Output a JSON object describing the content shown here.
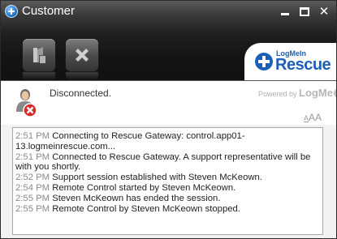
{
  "window": {
    "title": "Customer",
    "controls": {
      "minimize_icon": "minimize-icon",
      "maximize_icon": "maximize-icon",
      "close_symbol": "✕"
    }
  },
  "toolbar": {
    "buttons": [
      {
        "name": "reconnect",
        "icon": "connect-icon"
      },
      {
        "name": "end-session",
        "icon": "close-x-icon"
      }
    ]
  },
  "logo": {
    "top_text": "LogMeIn",
    "main_text": "Rescue"
  },
  "status": {
    "text": "Disconnected.",
    "icon": "user-disconnected-icon"
  },
  "powered_by": {
    "prefix": "Powered by",
    "brand": "LogMe"
  },
  "font_size_control": {
    "small": "A",
    "large": "AA"
  },
  "chat": {
    "messages": [
      {
        "time": "2:51 PM",
        "text": "Connecting to Rescue Gateway: control.app01-13.logmeinrescue.com..."
      },
      {
        "time": "2:51 PM",
        "text": "Connected to Rescue Gateway. A support representative will be with you shortly."
      },
      {
        "time": "2:52 PM",
        "text": "Support session established with Steven McKeown."
      },
      {
        "time": "2:54 PM",
        "text": "Remote Control started by Steven McKeown."
      },
      {
        "time": "2:55 PM",
        "text": "Steven McKeown has ended the session."
      },
      {
        "time": "2:55 PM",
        "text": "Remote Control by Steven McKeown stopped."
      }
    ]
  },
  "colors": {
    "brand_blue": "#1d5fb8",
    "titlebar_dark": "#141414",
    "error_red": "#d42a2a"
  }
}
